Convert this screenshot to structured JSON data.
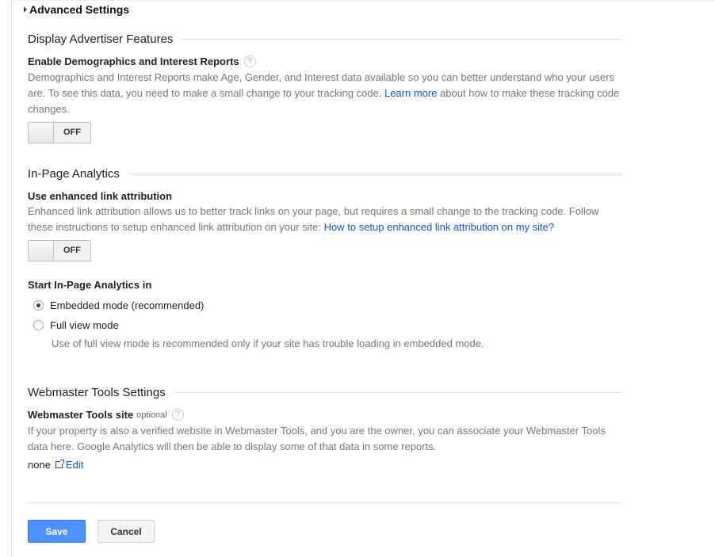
{
  "advanced_settings": {
    "label": "Advanced Settings"
  },
  "display_advertiser": {
    "title": "Display Advertiser Features",
    "demographics_label": "Enable Demographics and Interest Reports",
    "description_before": "Demographics and Interest Reports make Age, Gender, and Interest data available so you can better understand who your users are. To see this data, you need to make a small change to your tracking code. ",
    "learn_more": "Learn more",
    "description_after": " about how to make these tracking code changes.",
    "toggle_state": "OFF"
  },
  "in_page_analytics": {
    "title": "In-Page Analytics",
    "link_attr_label": "Use enhanced link attribution",
    "description": "Enhanced link attribution allows us to better track links on your page, but requires a small change to the tracking code. Follow these instructions to setup enhanced link attribution on your site: ",
    "howto_link": "How to setup enhanced link attribution on my site?",
    "toggle_state": "OFF",
    "start_label": "Start In-Page Analytics in",
    "option_embedded": "Embedded mode (recommended)",
    "option_fullview": "Full view mode",
    "fullview_note": "Use of full view mode is recommended only if your site has trouble loading in embedded mode.",
    "selected": "embedded"
  },
  "webmaster": {
    "title": "Webmaster Tools Settings",
    "site_label": "Webmaster Tools site",
    "optional": "optional",
    "description": "If your property is also a verified website in Webmaster Tools, and you are the owner, you can associate your Webmaster Tools data here. Google Analytics will then be able to display some of that data in some reports.",
    "value": "none",
    "edit": "Edit"
  },
  "help_glyph": "?",
  "buttons": {
    "save": "Save",
    "cancel": "Cancel"
  },
  "colors": {
    "link": "#1155cc",
    "save_bg": "#4d90fe"
  }
}
